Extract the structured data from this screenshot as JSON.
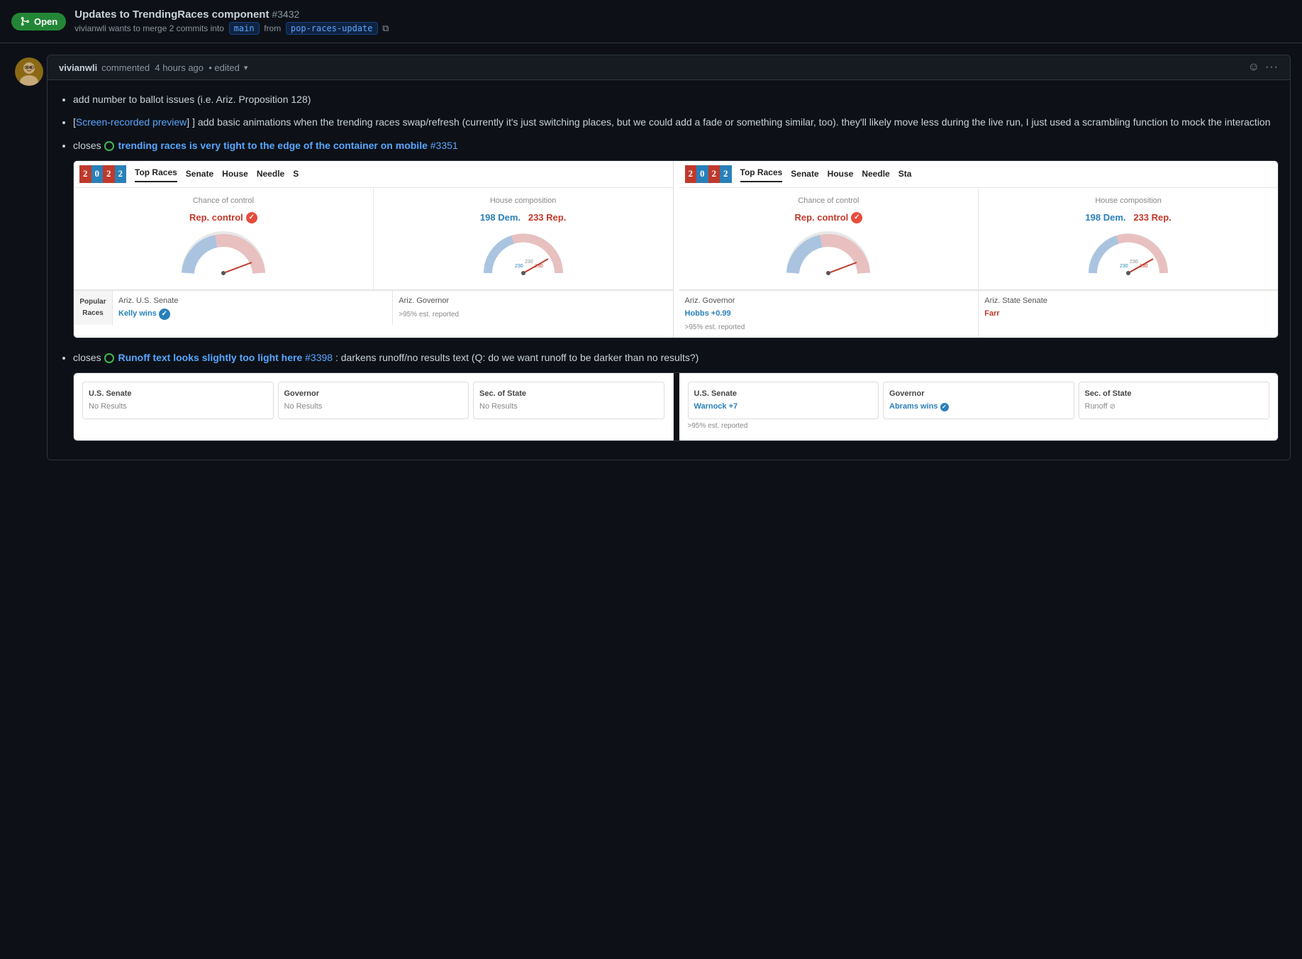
{
  "header": {
    "open_badge": "Open",
    "open_icon": "git-merge-icon",
    "pr_title": "Updates to TrendingRaces component",
    "pr_number": "#3432",
    "pr_meta": "vivianwli wants to merge 2 commits into",
    "branch_main": "main",
    "branch_from": "pop-races-update"
  },
  "comment": {
    "author": "vivianwli",
    "action": "commented",
    "time": "4 hours ago",
    "edited_label": "• edited",
    "bullet1": "add number to ballot issues (i.e. Ariz. Proposition 128)",
    "bullet2_pre": "[",
    "bullet2_link": "Screen-recorded preview",
    "bullet2_post": "] add basic animations when the trending races swap/refresh (currently it's just switching places, but we could add a fade or something similar, too). they'll likely move less during the live run, I just used a scrambling function to mock the interaction",
    "bullet3_pre": "closes ",
    "bullet3_issue_text": "trending races is very tight to the edge of the container on mobile",
    "bullet3_issue_num": "#3351",
    "bullet4_pre": "closes ",
    "bullet4_issue_text": "Runoff text looks slightly too light here",
    "bullet4_issue_num": "#3398",
    "bullet4_post": ": darkens runoff/no results text (Q: do we want runoff to be darker than no results?)"
  },
  "preview_left": {
    "year": "2022",
    "nav_tabs": [
      "Top Races",
      "Senate",
      "House",
      "Needle",
      "S"
    ],
    "stat1_label": "Chance of control",
    "stat1_value": "Rep. control",
    "stat2_label": "House composition",
    "stat2_value": "198 Dem.  233 Rep.",
    "popular_label": "Popular\nRaces",
    "race1_name": "Ariz. U.S. Senate",
    "race1_result": "Kelly wins",
    "race2_name": "Ariz. Governor",
    "race2_est": ">95% est. reported"
  },
  "preview_right": {
    "year": "2022",
    "nav_tabs": [
      "Top Races",
      "Senate",
      "House",
      "Needle",
      "Sta"
    ],
    "stat1_label": "Chance of control",
    "stat1_value": "Rep. control",
    "stat2_label": "House composition",
    "stat2_value": "198 Dem.  233 Rep.",
    "race1_name": "Ariz. Governor",
    "race1_result": "Hobbs +0.99",
    "race2_name": "Ariz. State Senate",
    "race2_result": "Farr",
    "race_est": ">95% est. reported"
  },
  "no_results_left": {
    "card1_title": "U.S. Senate",
    "card1_value": "No Results",
    "card2_title": "Governor",
    "card2_value": "No Results",
    "card3_title": "Sec. of State",
    "card3_value": "No Results"
  },
  "no_results_right": {
    "card1_title": "U.S. Senate",
    "card1_value": "Warnock +7",
    "card2_title": "Governor",
    "card2_value": "Abrams wins",
    "card3_title": "Sec. of State",
    "card3_value": "Runoff",
    "est_reported": ">95% est. reported"
  },
  "icons": {
    "git_merge": "⑃",
    "smiley": "☺",
    "ellipsis": "···",
    "check": "✓",
    "copy": "⧉"
  }
}
